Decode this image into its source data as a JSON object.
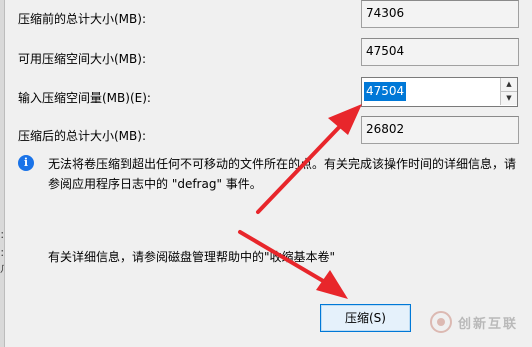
{
  "fields": {
    "total_before": {
      "label": "压缩前的总计大小(MB):",
      "value": "74306"
    },
    "available": {
      "label": "可用压缩空间大小(MB):",
      "value": "47504"
    },
    "shrink_input": {
      "label": "输入压缩空间量(MB)(E):",
      "value": "47504"
    },
    "total_after": {
      "label": "压缩后的总计大小(MB):",
      "value": "26802"
    }
  },
  "info": {
    "icon": "info-icon",
    "text": "无法将卷压缩到超出任何不可移动的文件所在的点。有关完成该操作时间的详细信息，请参阅应用程序日志中的 \"defrag\" 事件。"
  },
  "detail": {
    "text": "有关详细信息，请参阅磁盘管理帮助中的\"收缩基本卷\""
  },
  "buttons": {
    "shrink": "压缩(S)"
  },
  "watermark": {
    "text": "创新互联"
  },
  "colors": {
    "arrow": "#e8262b",
    "selection": "#0078d7",
    "info": "#1a73e8"
  }
}
